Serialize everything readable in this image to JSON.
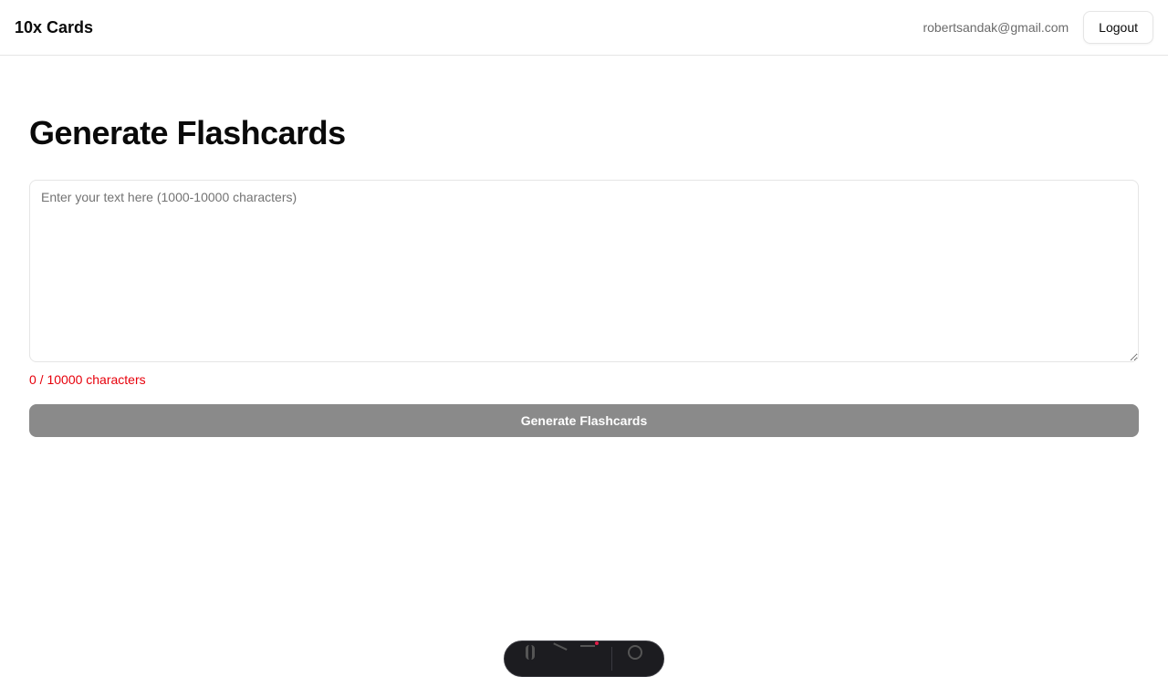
{
  "header": {
    "brand": "10x Cards",
    "email": "robertsandak@gmail.com",
    "logout_label": "Logout"
  },
  "main": {
    "title": "Generate Flashcards",
    "textarea_placeholder": "Enter your text here (1000-10000 characters)",
    "textarea_value": "",
    "counter": "0 / 10000 characters",
    "generate_label": "Generate Flashcards"
  },
  "colors": {
    "counter_error": "#e7000b",
    "button_disabled": "#8a8a8a"
  },
  "dev_toolbar": {
    "icons": [
      "menu-icon",
      "inspect-icon",
      "audit-icon",
      "settings-icon"
    ]
  }
}
